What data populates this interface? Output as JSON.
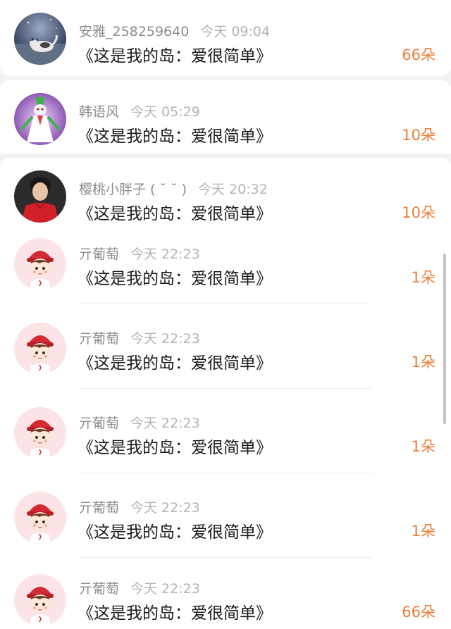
{
  "rows": [
    {
      "name": "安雅_258259640",
      "time": "今天 09:04",
      "title": "《这是我的岛：爱很简单》",
      "amount": "66朵",
      "avatar": "cat-night-avatar"
    },
    {
      "name": "韩语风",
      "time": "今天 05:29",
      "title": "《这是我的岛：爱很简单》",
      "amount": "10朵",
      "avatar": "pokemon-avatar"
    },
    {
      "name": "樱桃小胖子 ( ˘ ˘ )",
      "time": "今天 20:32",
      "title": "《这是我的岛：爱很简单》",
      "amount": "10朵",
      "avatar": "person-red-shirt-avatar"
    },
    {
      "name": "亓葡萄",
      "time": "今天 22:23",
      "title": "《这是我的岛：爱很简单》",
      "amount": "1朵",
      "avatar": "cartoon-boy-avatar"
    },
    {
      "name": "亓葡萄",
      "time": "今天 22:23",
      "title": "《这是我的岛：爱很简单》",
      "amount": "1朵",
      "avatar": "cartoon-boy-avatar"
    },
    {
      "name": "亓葡萄",
      "time": "今天 22:23",
      "title": "《这是我的岛：爱很简单》",
      "amount": "1朵",
      "avatar": "cartoon-boy-avatar"
    },
    {
      "name": "亓葡萄",
      "time": "今天 22:23",
      "title": "《这是我的岛：爱很简单》",
      "amount": "1朵",
      "avatar": "cartoon-boy-avatar"
    },
    {
      "name": "亓葡萄",
      "time": "今天 22:23",
      "title": "《这是我的岛：爱很简单》",
      "amount": "66朵",
      "avatar": "cartoon-boy-avatar"
    }
  ],
  "colors": {
    "amount": "#f07b32",
    "name": "#8c8c8c",
    "time": "#b4b4b4",
    "title": "#1a1a1a",
    "background": "#f2f2f2",
    "card": "#ffffff"
  }
}
